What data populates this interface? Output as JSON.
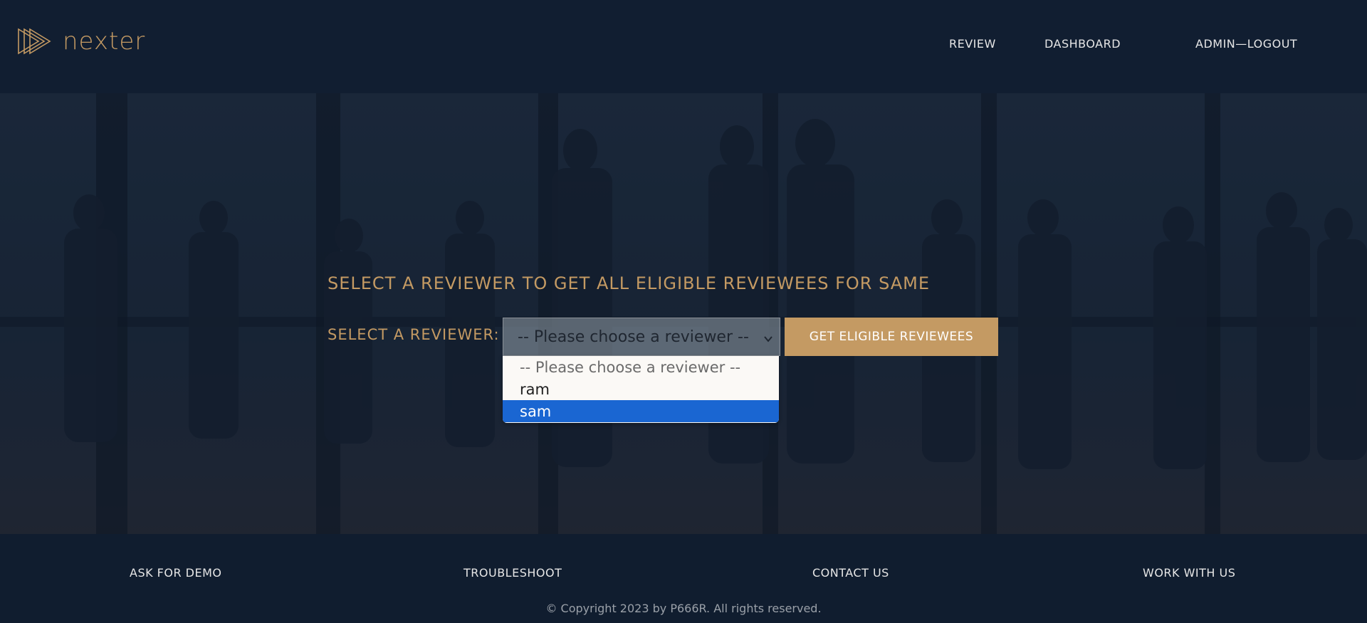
{
  "brand": {
    "name": "nexter",
    "logo_icon": "triple-play-logo-icon",
    "accent": "#c49a63"
  },
  "nav": {
    "review": "REVIEW",
    "dashboard": "DASHBOARD",
    "logout": "ADMIN—LOGOUT"
  },
  "hero": {
    "title": "SELECT A REVIEWER TO GET ALL ELIGIBLE REVIEWEES FOR SAME",
    "reviewer_label": "SELECT A REVIEWER:",
    "select": {
      "value": "-- Please choose a reviewer --",
      "options": [
        "-- Please choose a reviewer --",
        "ram",
        "sam"
      ],
      "highlighted": "sam"
    },
    "button_label": "GET ELIGIBLE REVIEWEES"
  },
  "footer": {
    "links": [
      "ASK FOR DEMO",
      "TROUBLESHOOT",
      "CONTACT US",
      "WORK WITH US"
    ],
    "copyright": "© Copyright 2023 by P666R. All rights reserved."
  },
  "colors": {
    "background": "#101d2f",
    "highlight": "#1a66d2",
    "button": "#c49a63"
  }
}
